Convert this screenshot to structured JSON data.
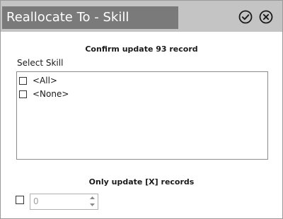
{
  "dialog": {
    "title": "Reallocate To - Skill",
    "confirm_icon": "check-circle-icon",
    "close_icon": "close-circle-icon"
  },
  "confirm_message": "Confirm update 93 record",
  "select_skill": {
    "label": "Select Skill",
    "options": [
      {
        "label": "<All>",
        "checked": false
      },
      {
        "label": "<None>",
        "checked": false
      }
    ]
  },
  "limit": {
    "label": "Only update [X] records",
    "checked": false,
    "value": "0"
  }
}
